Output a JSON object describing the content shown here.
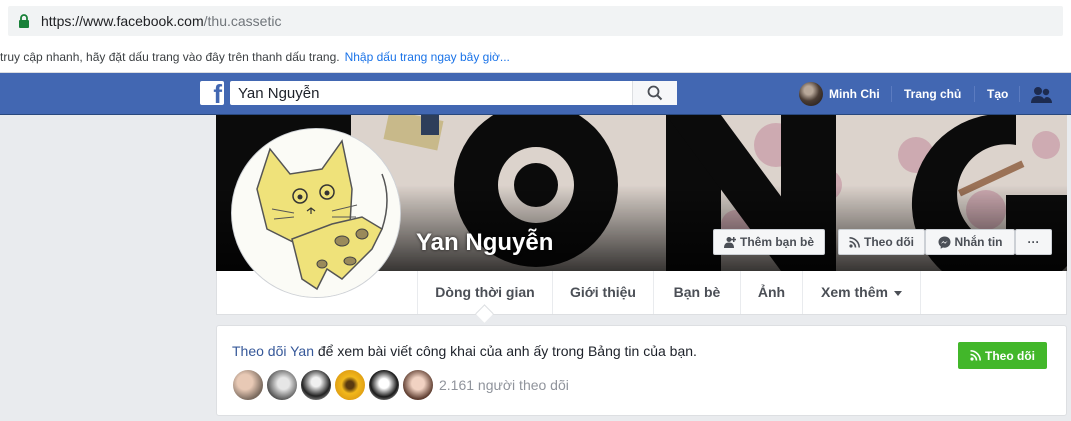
{
  "browser": {
    "url_domain": "https://www.facebook.com",
    "url_path": "/thu.cassetic",
    "bookmarks_hint": "truy cập nhanh, hãy đặt dấu trang vào đây trên thanh dấu trang.",
    "bookmarks_link": "Nhập dấu trang ngay bây giờ..."
  },
  "nav": {
    "logo": "f",
    "search_value": "Yan Nguyễn",
    "user_name": "Minh Chi",
    "home": "Trang chủ",
    "create": "Tạo"
  },
  "profile": {
    "name": "Yan Nguyễn",
    "add_friend": "Thêm bạn bè",
    "follow": "Theo dõi",
    "message": "Nhắn tin",
    "more": "···"
  },
  "tabs": {
    "timeline": "Dòng thời gian",
    "about": "Giới thiệu",
    "friends": "Bạn bè",
    "photos": "Ảnh",
    "more": "Xem thêm"
  },
  "follow_card": {
    "link": "Theo dõi Yan",
    "text": " để xem bài viết công khai của anh ấy trong Bảng tin của bạn.",
    "button": "Theo dõi",
    "count": "2.161 người theo dõi"
  },
  "colors": {
    "facebook_blue": "#4267b2",
    "follow_green": "#42b72a",
    "link_blue": "#365899"
  }
}
